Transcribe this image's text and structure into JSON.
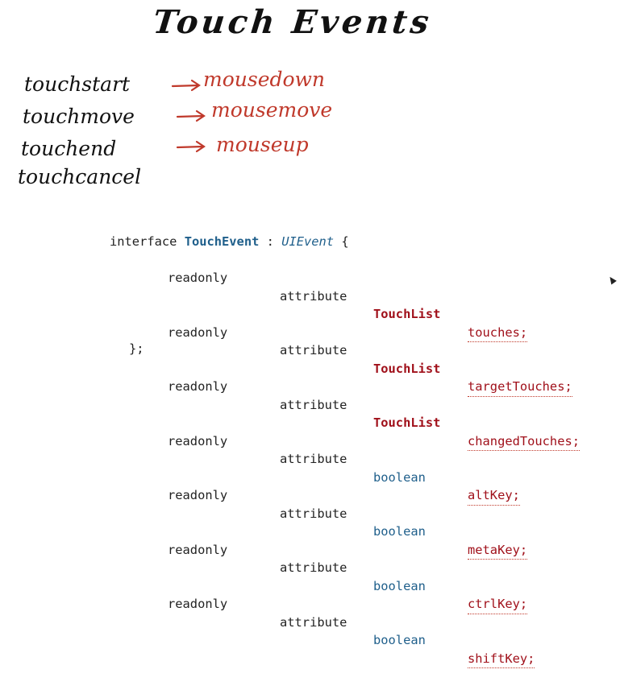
{
  "title": "Touch Events",
  "mappings": [
    {
      "touch": "touchstart",
      "mouse": "mousedown"
    },
    {
      "touch": "touchmove",
      "mouse": "mousemove"
    },
    {
      "touch": "touchend",
      "mouse": "mouseup"
    },
    {
      "touch": "touchcancel",
      "mouse": ""
    }
  ],
  "code": {
    "interface_kw": "interface",
    "interface_name": "TouchEvent",
    "colon": ":",
    "parent": "UIEvent",
    "open_brace": "{",
    "close": "};",
    "readonly_kw": "readonly",
    "attribute_kw": "attribute",
    "members": [
      {
        "type": "TouchList",
        "name": "touches;"
      },
      {
        "type": "TouchList",
        "name": "targetTouches;"
      },
      {
        "type": "TouchList",
        "name": "changedTouches;"
      },
      {
        "type": "boolean",
        "name": "altKey;"
      },
      {
        "type": "boolean",
        "name": "metaKey;"
      },
      {
        "type": "boolean",
        "name": "ctrlKey;"
      },
      {
        "type": "boolean",
        "name": "shiftKey;"
      }
    ]
  },
  "colors": {
    "ink": "#111111",
    "red_ink": "#c0392b",
    "type_red": "#a0101a",
    "blue": "#1f5f8b"
  }
}
